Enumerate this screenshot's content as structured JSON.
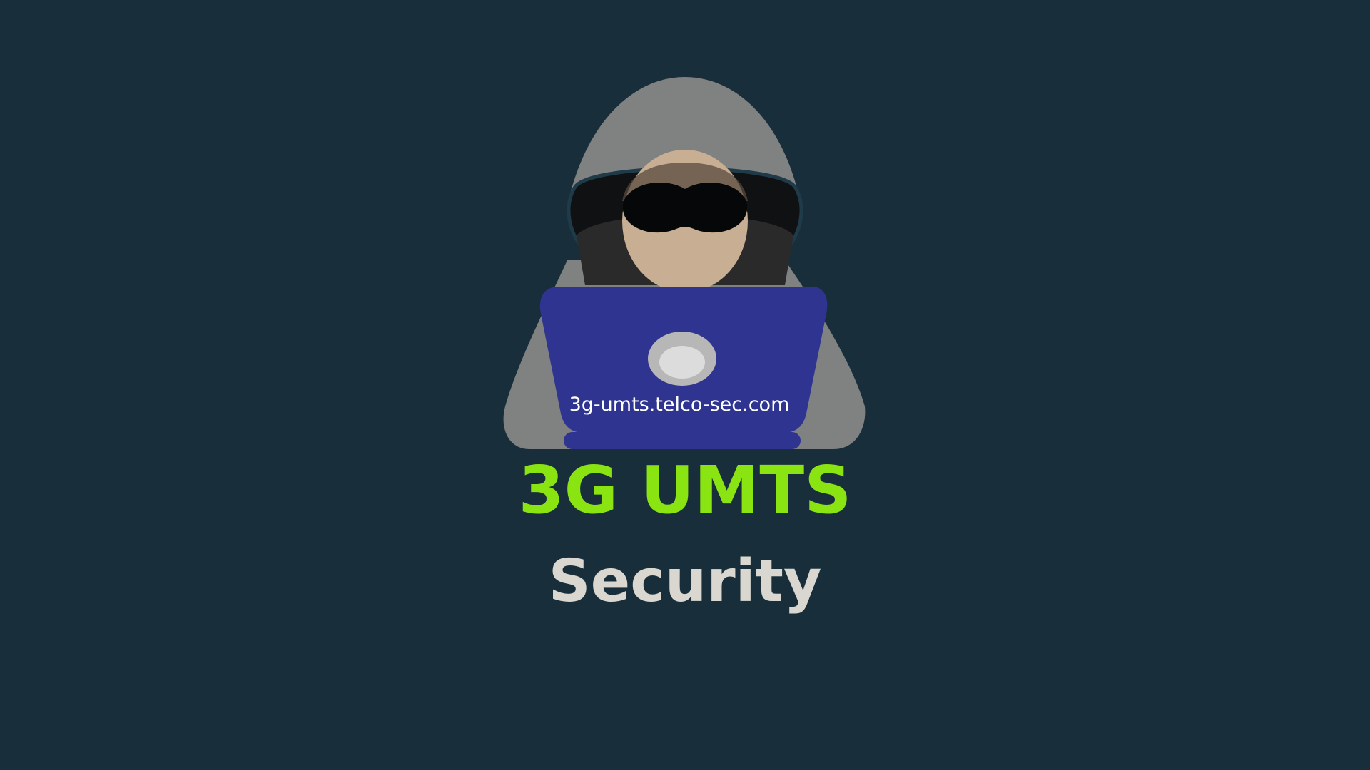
{
  "banner": {
    "laptop_url": "3g-umts.telco-sec.com",
    "title": "3G UMTS",
    "subtitle": "Security"
  },
  "colors": {
    "background": "#182f3b",
    "title": "#8ae412",
    "subtitle": "#d9d7cf",
    "laptop": "#2e3490",
    "hood": "#808181"
  },
  "icons": [
    "hacker-icon",
    "laptop-icon",
    "mask-icon",
    "hood-icon"
  ]
}
